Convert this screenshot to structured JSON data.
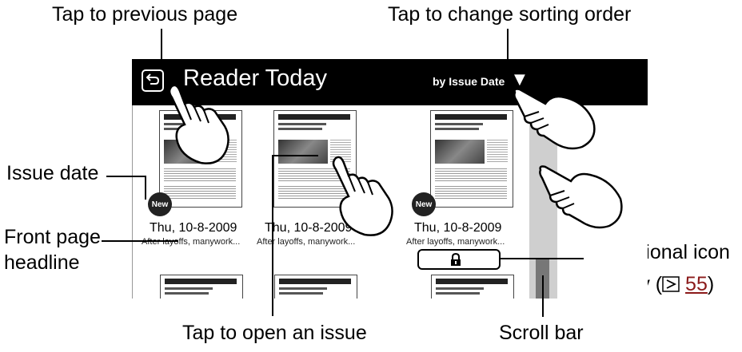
{
  "callouts": {
    "previous_page": "Tap to previous page",
    "sorting_order": "Tap to change sorting order",
    "issue_date": "Issue date",
    "front_page_headline_1": "Front page",
    "front_page_headline_2": "headline",
    "conditional_icon_1": "Conditional icon",
    "conditional_icon_2": "display (",
    "conditional_icon_ref": "55",
    "conditional_icon_3": ")",
    "open_issue": "Tap to open an issue",
    "scroll_bar": "Scroll bar"
  },
  "reader": {
    "title": "Reader Today",
    "sort_label": "by Issue Date",
    "sort_arrow": "▼",
    "issues": [
      {
        "date": "Thu, 10-8-2009",
        "headline": "After layoffs, manywork...",
        "new_badge": "New",
        "is_new": true
      },
      {
        "date": "Thu, 10-8-2009",
        "headline": "After layoffs, manywork...",
        "is_new": false
      },
      {
        "date": "Thu, 10-8-2009",
        "headline": "After layoffs, manywork...",
        "new_badge": "New",
        "is_new": true
      }
    ]
  },
  "icons": {
    "back": "back-arrow-icon",
    "lock": "lock-icon",
    "hand": "hand-pointer-icon",
    "reference": "page-reference-arrow-icon"
  },
  "colors": {
    "title_bar": "#000000",
    "scroll_track": "#cfcfcf",
    "scroll_thumb": "#777777"
  }
}
